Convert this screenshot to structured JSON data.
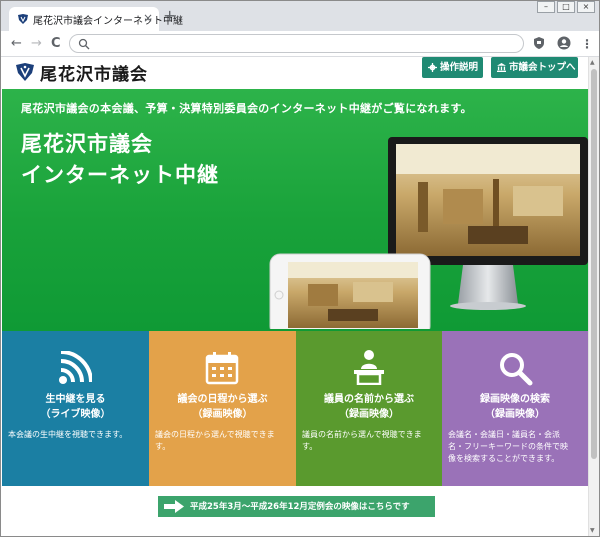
{
  "browser": {
    "tab_title": "尾花沢市議会インターネット中継",
    "tab_close": "×",
    "new_tab": "+",
    "nav_back": "←",
    "nav_forward": "→",
    "nav_reload": "C",
    "address_value": "",
    "menu": "⋮",
    "win_min": "–",
    "win_max": "□",
    "win_close": "×"
  },
  "header": {
    "site_name": "尾花沢市議会",
    "btn_guide": "操作説明",
    "btn_top": "市議会トップへ",
    "accent": "#1f8a73"
  },
  "hero": {
    "subtitle": "尾花沢市議会の本会議、予算・決算特別委員会のインターネット中継がご覧になれます。",
    "title_line1": "尾花沢市議会",
    "title_line2": "インターネット中継"
  },
  "tiles": [
    {
      "title1": "生中継を見る",
      "title2": "（ライブ映像）",
      "desc": [
        "本会議の生中継を視聴できます。"
      ],
      "color": "#1b7fa3",
      "icon": "live-signal-icon"
    },
    {
      "title1": "議会の日程から選ぶ",
      "title2": "（録画映像）",
      "desc": [
        "議会の日程から選んで視聴できま",
        "す。"
      ],
      "color": "#e3a24a",
      "icon": "calendar-icon"
    },
    {
      "title1": "議員の名前から選ぶ",
      "title2": "（録画映像）",
      "desc": [
        "議員の名前から選んで視聴できま",
        "す。"
      ],
      "color": "#5a9a2e",
      "icon": "speaker-podium-icon"
    },
    {
      "title1": "録画映像の検索",
      "title2": "（録画映像）",
      "desc": [
        "会議名・会議日・議員名・会派",
        "名・フリーキーワードの条件で映",
        "像を検索することができます。"
      ],
      "color": "#9a72b8",
      "icon": "search-icon"
    }
  ],
  "archive_link": "平成25年3月～平成26年12月定例会の映像はこちらです"
}
